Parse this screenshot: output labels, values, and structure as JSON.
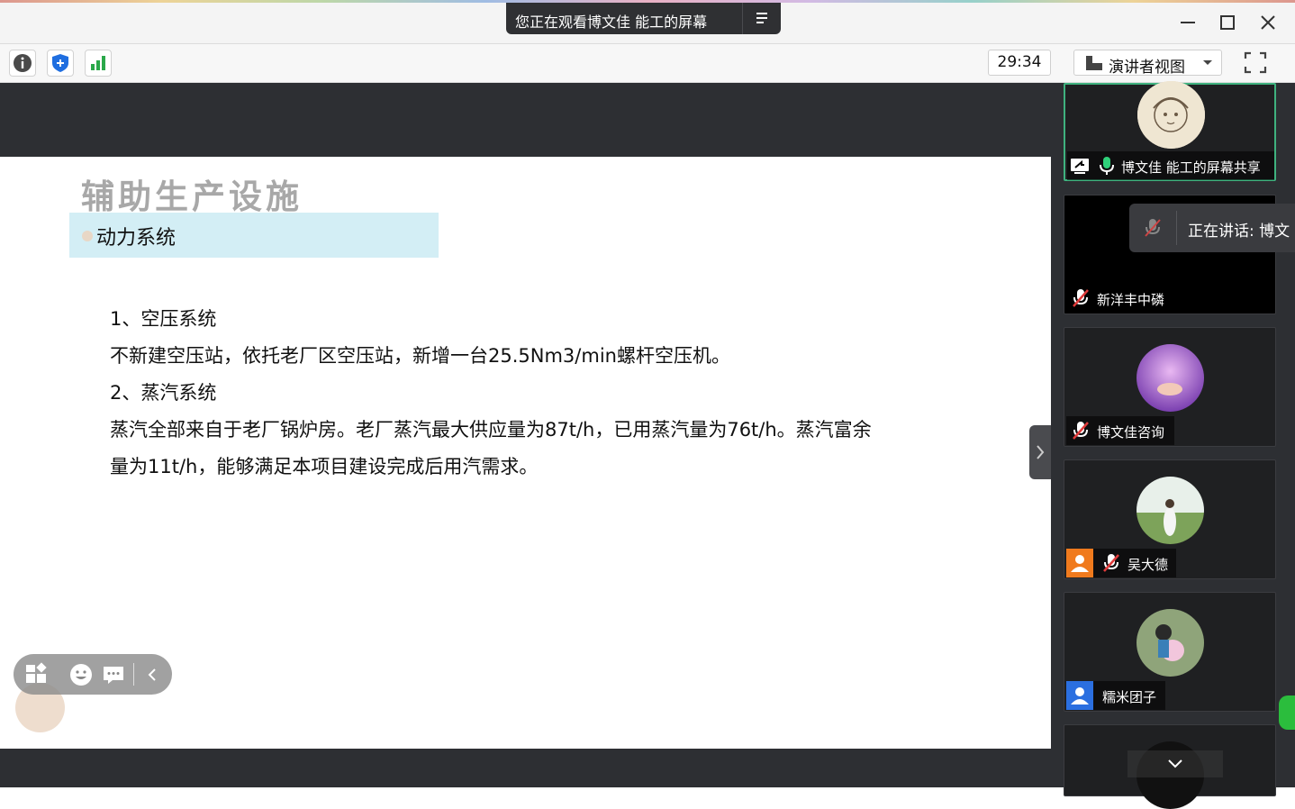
{
  "window": {
    "share_banner": "您正在观看博文佳 能工的屏幕",
    "controls": [
      "minimize-icon",
      "maximize-icon",
      "close-icon"
    ]
  },
  "toolbar": {
    "timer": "29:34",
    "view_mode": "演讲者视图",
    "icons": [
      "info-icon",
      "shield-icon",
      "signal-bars-icon",
      "fullscreen-icon"
    ]
  },
  "slide": {
    "title": "辅助生产设施",
    "section": "动力系统",
    "lines": [
      "1、空压系统",
      "不新建空压站，依托老厂区空压站，新增一台25.5Nm3/min螺杆空压机。",
      "2、蒸汽系统",
      "蒸汽全部来自于老厂锅炉房。老厂蒸汽最大供应量为87t/h，已用蒸汽量为76t/h。蒸汽富余",
      "量为11t/h，能够满足本项目建设完成后用汽需求。"
    ]
  },
  "participants": [
    {
      "name": "博文佳 能工的屏幕共享",
      "mic": "on",
      "sharing": true
    },
    {
      "name": "新洋丰中磷",
      "mic": "muted"
    },
    {
      "name": "博文佳咨询",
      "mic": "muted"
    },
    {
      "name": "吴大德",
      "mic": "muted"
    },
    {
      "name": "糯米团子",
      "mic": "none"
    }
  ],
  "speaking": "正在讲话: 博文",
  "colors": {
    "accent_green": "#3fb27f",
    "dark_bg": "#2d2f33",
    "section_bg": "#d3eef5",
    "title_gray": "#a8a8a8"
  }
}
